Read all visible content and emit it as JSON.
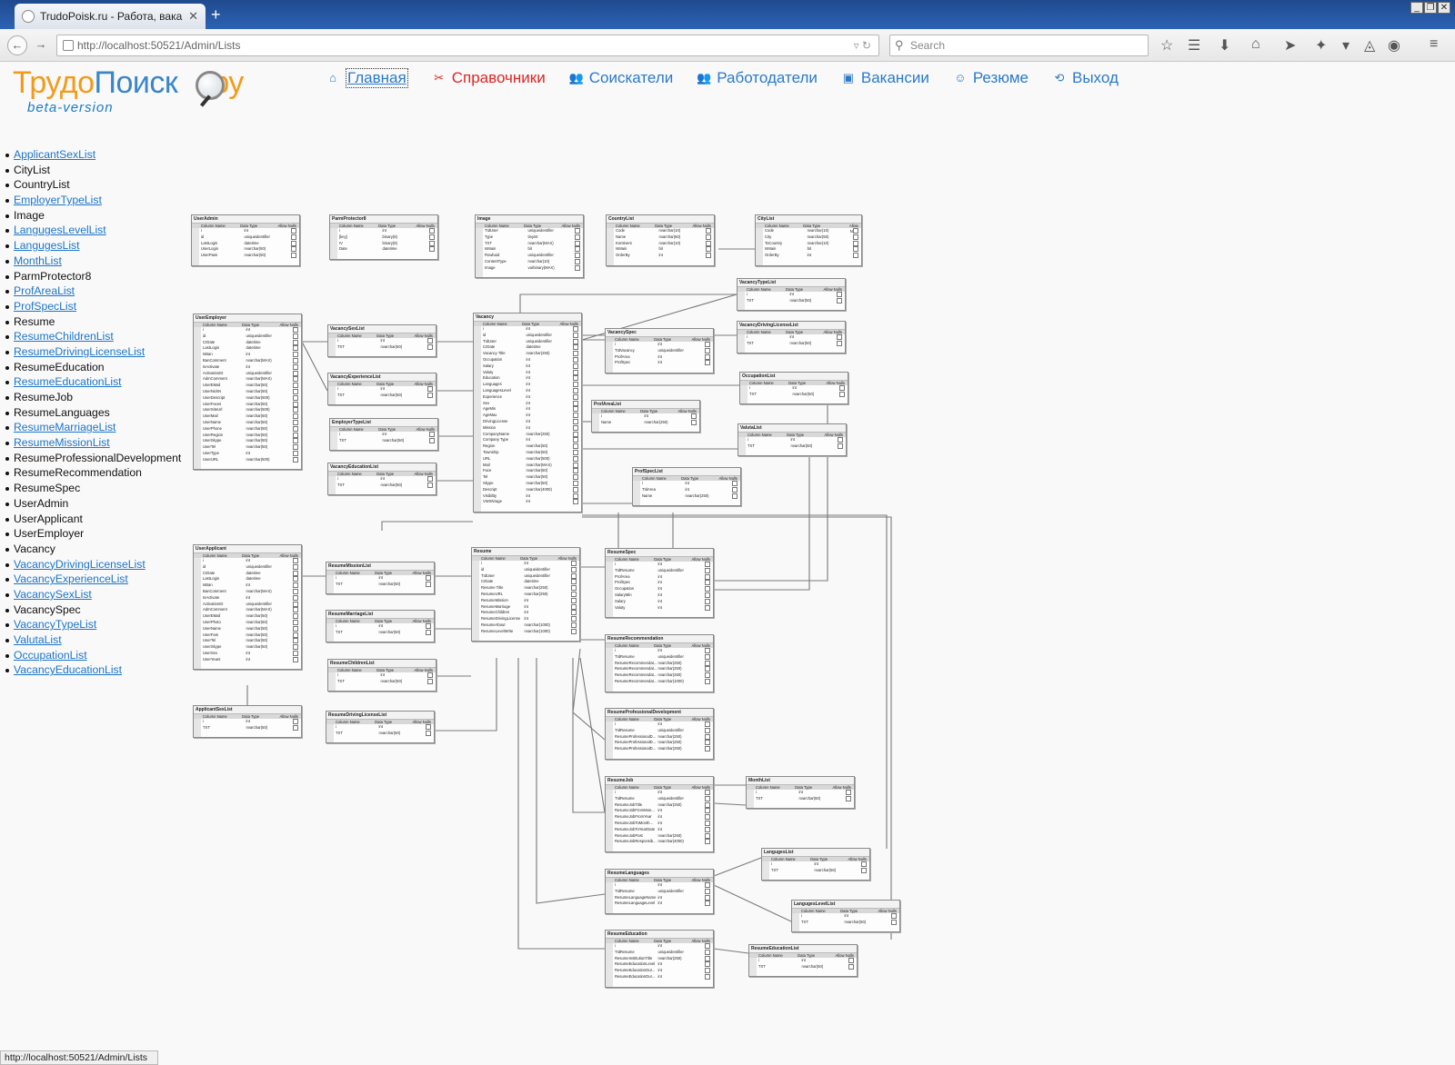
{
  "browser": {
    "tab_title": "TrudoPoisk.ru - Работа, вака...",
    "url": "http://localhost:50521/Admin/Lists",
    "search_placeholder": "Search",
    "status_url": "http://localhost:50521/Admin/Lists"
  },
  "logo": {
    "part1": "Трудо",
    "part2": "Поиск",
    "part3": "ру",
    "beta": "beta-version"
  },
  "mainnav": [
    {
      "label": "Главная",
      "icon": "home-icon",
      "active": true
    },
    {
      "label": "Справочники",
      "icon": "tools-icon",
      "red": true
    },
    {
      "label": "Соискатели",
      "icon": "users-icon"
    },
    {
      "label": "Работодатели",
      "icon": "users-icon"
    },
    {
      "label": "Вакансии",
      "icon": "document-icon"
    },
    {
      "label": "Резюме",
      "icon": "person-icon"
    },
    {
      "label": "Выход",
      "icon": "exit-icon"
    }
  ],
  "lists": [
    {
      "label": "ApplicantSexList",
      "link": true
    },
    {
      "label": "CityList",
      "link": false
    },
    {
      "label": "CountryList",
      "link": false
    },
    {
      "label": "EmployerTypeList",
      "link": true
    },
    {
      "label": "Image",
      "link": false
    },
    {
      "label": "LangugesLevelList",
      "link": true
    },
    {
      "label": "LangugesList",
      "link": true
    },
    {
      "label": "MonthList",
      "link": true
    },
    {
      "label": "ParmProtector8",
      "link": false
    },
    {
      "label": "ProfAreaList",
      "link": true
    },
    {
      "label": "ProfSpecList",
      "link": true
    },
    {
      "label": "Resume",
      "link": false
    },
    {
      "label": "ResumeChildrenList",
      "link": true
    },
    {
      "label": "ResumeDrivingLicenseList",
      "link": true
    },
    {
      "label": "ResumeEducation",
      "link": false
    },
    {
      "label": "ResumeEducationList",
      "link": true
    },
    {
      "label": "ResumeJob",
      "link": false
    },
    {
      "label": "ResumeLanguages",
      "link": false
    },
    {
      "label": "ResumeMarriageList",
      "link": true
    },
    {
      "label": "ResumeMissionList",
      "link": true
    },
    {
      "label": "ResumeProfessionalDevelopment",
      "link": false
    },
    {
      "label": "ResumeRecommendation",
      "link": false
    },
    {
      "label": "ResumeSpec",
      "link": false
    },
    {
      "label": "UserAdmin",
      "link": false
    },
    {
      "label": "UserApplicant",
      "link": false
    },
    {
      "label": "UserEmployer",
      "link": false
    },
    {
      "label": "Vacancy",
      "link": false
    },
    {
      "label": "VacancyDrivingLicenseList",
      "link": true
    },
    {
      "label": "VacancyExperienceList",
      "link": true
    },
    {
      "label": "VacancySexList",
      "link": true
    },
    {
      "label": "VacancySpec",
      "link": false
    },
    {
      "label": "VacancyTypeList",
      "link": true
    },
    {
      "label": "ValutaList",
      "link": true
    },
    {
      "label": "OccupationList",
      "link": true
    },
    {
      "label": "VacancyEducationList",
      "link": true
    }
  ],
  "diagram": {
    "column_headers": {
      "name": "Column Name",
      "type": "Data Type",
      "nulls": "Allow Nulls"
    },
    "tables": [
      {
        "name": "UserAdmin",
        "rows": [
          [
            "i",
            "int"
          ],
          [
            "id",
            "uniqueidentifier"
          ],
          [
            "LastLogin",
            "datetime"
          ],
          [
            "UserLogin",
            "nvarchar(50)"
          ],
          [
            "UserPass",
            "nvarchar(50)"
          ]
        ]
      },
      {
        "name": "ParmProtector8",
        "rows": [
          [
            "i",
            "int"
          ],
          [
            "[key]",
            "binary(8)"
          ],
          [
            "IV",
            "binary(8)"
          ],
          [
            "Date",
            "datetime"
          ]
        ]
      },
      {
        "name": "Image",
        "rows": [
          [
            "TIdUser",
            "uniqueidentifier"
          ],
          [
            "Type",
            "tinyint"
          ],
          [
            "TXT",
            "nvarchar(MAX)"
          ],
          [
            "IsMain",
            "bit"
          ],
          [
            "Rowbuid",
            "uniqueidentifier"
          ],
          [
            "ContentType",
            "nvarchar(10)"
          ],
          [
            "Image",
            "varbinary(MAX)"
          ]
        ]
      },
      {
        "name": "CountryList",
        "rows": [
          [
            "Code",
            "nvarchar(10)"
          ],
          [
            "Name",
            "nvarchar(50)"
          ],
          [
            "Kontinent",
            "nvarchar(10)"
          ],
          [
            "IsMain",
            "bit"
          ],
          [
            "OrderBy",
            "int"
          ]
        ]
      },
      {
        "name": "CityList",
        "rows": [
          [
            "Code",
            "nvarchar(10)"
          ],
          [
            "City",
            "nvarchar(50)"
          ],
          [
            "ToCountry",
            "nvarchar(10)"
          ],
          [
            "IsMain",
            "bit"
          ],
          [
            "OrderBy",
            "int"
          ]
        ]
      },
      {
        "name": "VacancyTypeList",
        "rows": [
          [
            "i",
            "int"
          ],
          [
            "TXT",
            "nvarchar(50)"
          ]
        ]
      },
      {
        "name": "VacancyDrivingLicenseList",
        "rows": [
          [
            "i",
            "int"
          ],
          [
            "TXT",
            "nvarchar(50)"
          ]
        ]
      },
      {
        "name": "UserEmployer",
        "rows": [
          [
            "i",
            "int"
          ],
          [
            "id",
            "uniqueidentifier"
          ],
          [
            "CrDate",
            "datetime"
          ],
          [
            "LastLogin",
            "datetime"
          ],
          [
            "IsBan",
            "int"
          ],
          [
            "BanComment",
            "nvarchar(MAX)"
          ],
          [
            "IsActivate",
            "int"
          ],
          [
            "ActivationID",
            "uniqueidentifier"
          ],
          [
            "AdmComment",
            "nvarchar(MAX)"
          ],
          [
            "UserEMail",
            "nvarchar(50)"
          ],
          [
            "UserNickN",
            "nvarchar(50)"
          ],
          [
            "UserDescript",
            "nvarchar(500)"
          ],
          [
            "UserFaces",
            "nvarchar(50)"
          ],
          [
            "UserSiteUrl",
            "nvarchar(500)"
          ],
          [
            "UserMail",
            "nvarchar(50)"
          ],
          [
            "UserName",
            "nvarchar(50)"
          ],
          [
            "UserPhone",
            "nvarchar(50)"
          ],
          [
            "UserRegion",
            "nvarchar(50)"
          ],
          [
            "UserSkype",
            "nvarchar(50)"
          ],
          [
            "UserTel",
            "nvarchar(50)"
          ],
          [
            "UserType",
            "int"
          ],
          [
            "UserURL",
            "nvarchar(500)"
          ]
        ]
      },
      {
        "name": "VacancySexList",
        "rows": [
          [
            "i",
            "int"
          ],
          [
            "TXT",
            "nvarchar(50)"
          ]
        ]
      },
      {
        "name": "VacancyExperienceList",
        "rows": [
          [
            "i",
            "int"
          ],
          [
            "TXT",
            "nvarchar(50)"
          ]
        ]
      },
      {
        "name": "EmployerTypeList",
        "rows": [
          [
            "i",
            "int"
          ],
          [
            "TXT",
            "nvarchar(50)"
          ]
        ]
      },
      {
        "name": "VacancyEducationList",
        "rows": [
          [
            "i",
            "int"
          ],
          [
            "TXT",
            "nvarchar(50)"
          ]
        ]
      },
      {
        "name": "Vacancy",
        "rows": [
          [
            "i",
            "int"
          ],
          [
            "id",
            "uniqueidentifier"
          ],
          [
            "TIdUser",
            "uniqueidentifier"
          ],
          [
            "CrDate",
            "datetime"
          ],
          [
            "Vacancy Title",
            "nvarchar(250)"
          ],
          [
            "Occupation",
            "int"
          ],
          [
            "Salary",
            "int"
          ],
          [
            "Valuty",
            "int"
          ],
          [
            "Education",
            "int"
          ],
          [
            "Languages",
            "int"
          ],
          [
            "LanguagesLevel",
            "int"
          ],
          [
            "Experience",
            "int"
          ],
          [
            "Sex",
            "int"
          ],
          [
            "AgeMin",
            "int"
          ],
          [
            "AgeMax",
            "int"
          ],
          [
            "DrivingLicense",
            "int"
          ],
          [
            "Mission",
            "int"
          ],
          [
            "CompanyName",
            "nvarchar(250)"
          ],
          [
            "Company Type",
            "int"
          ],
          [
            "Region",
            "nvarchar(50)"
          ],
          [
            "Township",
            "nvarchar(50)"
          ],
          [
            "URL",
            "nvarchar(500)"
          ],
          [
            "Mail",
            "nvarchar(MAX)"
          ],
          [
            "Face",
            "nvarchar(50)"
          ],
          [
            "Tel",
            "nvarchar(50)"
          ],
          [
            "Skype",
            "nvarchar(50)"
          ],
          [
            "Descript",
            "nvarchar(4000)"
          ],
          [
            "Visibility",
            "int"
          ],
          [
            "VWSNrage",
            "int"
          ]
        ]
      },
      {
        "name": "VacancySpec",
        "rows": [
          [
            "i",
            "int"
          ],
          [
            "TIdVacancy",
            "uniqueidentifier"
          ],
          [
            "ProfArea",
            "int"
          ],
          [
            "ProfSpec",
            "int"
          ]
        ]
      },
      {
        "name": "OccupationList",
        "rows": [
          [
            "i",
            "int"
          ],
          [
            "TXT",
            "nvarchar(50)"
          ]
        ]
      },
      {
        "name": "ProfAreaList",
        "rows": [
          [
            "i",
            "int"
          ],
          [
            "Name",
            "nvarchar(250)"
          ]
        ]
      },
      {
        "name": "ValutaList",
        "rows": [
          [
            "i",
            "int"
          ],
          [
            "TXT",
            "nvarchar(50)"
          ]
        ]
      },
      {
        "name": "ProfSpecList",
        "rows": [
          [
            "i",
            "int"
          ],
          [
            "TIdArea",
            "int"
          ],
          [
            "Name",
            "nvarchar(250)"
          ]
        ]
      },
      {
        "name": "UserApplicant",
        "rows": [
          [
            "i",
            "int"
          ],
          [
            "id",
            "uniqueidentifier"
          ],
          [
            "CrDate",
            "datetime"
          ],
          [
            "LastLogin",
            "datetime"
          ],
          [
            "IsBan",
            "int"
          ],
          [
            "BanComment",
            "nvarchar(MAX)"
          ],
          [
            "IsActivate",
            "int"
          ],
          [
            "ActivationID",
            "uniqueidentifier"
          ],
          [
            "AdmComment",
            "nvarchar(MAX)"
          ],
          [
            "UserEMail",
            "nvarchar(50)"
          ],
          [
            "UserPhoto",
            "nvarchar(50)"
          ],
          [
            "UserName",
            "nvarchar(50)"
          ],
          [
            "UserFam",
            "nvarchar(50)"
          ],
          [
            "UserTel",
            "nvarchar(50)"
          ],
          [
            "UserSkype",
            "nvarchar(50)"
          ],
          [
            "UserSex",
            "int"
          ],
          [
            "UserYears",
            "int"
          ]
        ]
      },
      {
        "name": "ResumeMissionList",
        "rows": [
          [
            "i",
            "int"
          ],
          [
            "TXT",
            "nvarchar(50)"
          ]
        ]
      },
      {
        "name": "Resume",
        "rows": [
          [
            "i",
            "int"
          ],
          [
            "id",
            "uniqueidentifier"
          ],
          [
            "TIdUser",
            "uniqueidentifier"
          ],
          [
            "CrDate",
            "datetime"
          ],
          [
            "Resume Title",
            "nvarchar(250)"
          ],
          [
            "ResumeURL",
            "nvarchar(250)"
          ],
          [
            "ResumeMission",
            "int"
          ],
          [
            "ResumeMarriage",
            "int"
          ],
          [
            "ResumeChildren",
            "int"
          ],
          [
            "ResumeDrivingLicense",
            "int"
          ],
          [
            "ResumeAbout",
            "nvarchar(1000)"
          ],
          [
            "ResumeLevelWrite",
            "nvarchar(1000)"
          ]
        ]
      },
      {
        "name": "ResumeSpec",
        "rows": [
          [
            "i",
            "int"
          ],
          [
            "TIdResume",
            "uniqueidentifier"
          ],
          [
            "ProfArea",
            "int"
          ],
          [
            "ProfSpec",
            "int"
          ],
          [
            "Occupation",
            "int"
          ],
          [
            "SalaryMin",
            "int"
          ],
          [
            "Salary",
            "int"
          ],
          [
            "Valuty",
            "int"
          ]
        ]
      },
      {
        "name": "ResumeMarriageList",
        "rows": [
          [
            "i",
            "int"
          ],
          [
            "TXT",
            "nvarchar(50)"
          ]
        ]
      },
      {
        "name": "ResumeRecommendation",
        "rows": [
          [
            "i",
            "int"
          ],
          [
            "TIdResume",
            "uniqueidentifier"
          ],
          [
            "ResumeRecommendat...",
            "nvarchar(250)"
          ],
          [
            "ResumeRecommendat...",
            "nvarchar(250)"
          ],
          [
            "ResumeRecommendat...",
            "nvarchar(250)"
          ],
          [
            "ResumeRecommendat...",
            "nvarchar(1000)"
          ]
        ]
      },
      {
        "name": "ResumeChildrenList",
        "rows": [
          [
            "i",
            "int"
          ],
          [
            "TXT",
            "nvarchar(50)"
          ]
        ]
      },
      {
        "name": "ApplicantSexList",
        "rows": [
          [
            "i",
            "int"
          ],
          [
            "TXT",
            "nvarchar(50)"
          ]
        ]
      },
      {
        "name": "ResumeDrivingLicenseList",
        "rows": [
          [
            "i",
            "int"
          ],
          [
            "TXT",
            "nvarchar(50)"
          ]
        ]
      },
      {
        "name": "ResumeProfessionalDevelopment",
        "rows": [
          [
            "i",
            "int"
          ],
          [
            "TIdResume",
            "uniqueidentifier"
          ],
          [
            "ResumeProfessionalD...",
            "nvarchar(250)"
          ],
          [
            "ResumeProfessionalD...",
            "nvarchar(250)"
          ],
          [
            "ResumeProfessionalD...",
            "nvarchar(250)"
          ]
        ]
      },
      {
        "name": "ResumeJob",
        "rows": [
          [
            "i",
            "int"
          ],
          [
            "TIdResume",
            "uniqueidentifier"
          ],
          [
            "ResumeJobTitle",
            "nvarchar(250)"
          ],
          [
            "ResumeJobFromMon...",
            "int"
          ],
          [
            "ResumeJobFromYear",
            "int"
          ],
          [
            "ResumeJobToMonth...",
            "int"
          ],
          [
            "ResumeJobToYearDate",
            "int"
          ],
          [
            "ResumeJobPost",
            "nvarchar(250)"
          ],
          [
            "ResumeJobResponsib...",
            "nvarchar(4000)"
          ]
        ]
      },
      {
        "name": "MonthList",
        "rows": [
          [
            "i",
            "int"
          ],
          [
            "TXT",
            "nvarchar(50)"
          ]
        ]
      },
      {
        "name": "LangugesList",
        "rows": [
          [
            "i",
            "int"
          ],
          [
            "TXT",
            "nvarchar(50)"
          ]
        ]
      },
      {
        "name": "ResumeLanguages",
        "rows": [
          [
            "i",
            "int"
          ],
          [
            "TIdResume",
            "uniqueidentifier"
          ],
          [
            "ResumeLanguageName",
            "int"
          ],
          [
            "ResumeLanguageLevel",
            "int"
          ]
        ]
      },
      {
        "name": "LangugesLevelList",
        "rows": [
          [
            "i",
            "int"
          ],
          [
            "TXT",
            "nvarchar(50)"
          ]
        ]
      },
      {
        "name": "ResumeEducation",
        "rows": [
          [
            "i",
            "int"
          ],
          [
            "TIdResume",
            "uniqueidentifier"
          ],
          [
            "ResumeInstitutionTitle",
            "nvarchar(250)"
          ],
          [
            "ResumeEducationLevel",
            "int"
          ],
          [
            "ResumeEducationDur...",
            "int"
          ],
          [
            "ResumeEducationDur...",
            "int"
          ]
        ]
      },
      {
        "name": "ResumeEducationList",
        "rows": [
          [
            "i",
            "int"
          ],
          [
            "TXT",
            "nvarchar(50)"
          ]
        ]
      }
    ]
  }
}
